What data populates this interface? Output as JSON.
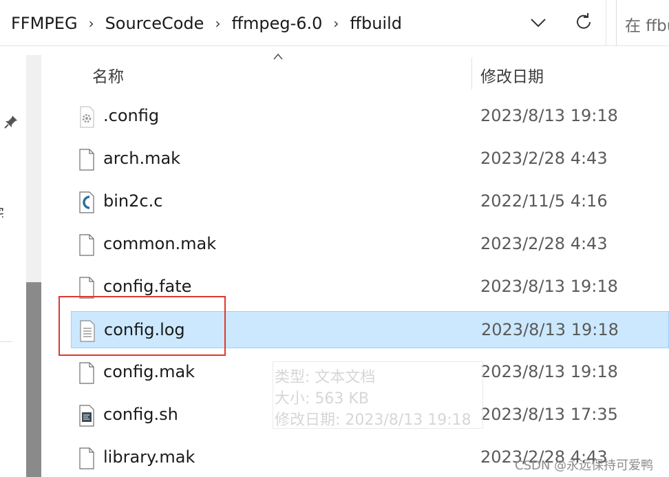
{
  "breadcrumb": {
    "segments": [
      "FFMPEG",
      "SourceCode",
      "ffmpeg-6.0",
      "ffbuild"
    ],
    "separator": "›"
  },
  "search": {
    "placeholder": "在 ffbuild"
  },
  "nav": {
    "fragment_text": "宅"
  },
  "columns": {
    "name": "名称",
    "date_modified": "修改日期"
  },
  "files": [
    {
      "name": ".config",
      "date": "2023/8/13 19:18",
      "icon": "config-file-icon",
      "selected": false
    },
    {
      "name": "arch.mak",
      "date": "2023/2/28 4:43",
      "icon": "blank-file-icon",
      "selected": false
    },
    {
      "name": "bin2c.c",
      "date": "2022/11/5 4:16",
      "icon": "c-source-file-icon",
      "selected": false
    },
    {
      "name": "common.mak",
      "date": "2023/2/28 4:43",
      "icon": "blank-file-icon",
      "selected": false
    },
    {
      "name": "config.fate",
      "date": "2023/8/13 19:18",
      "icon": "blank-file-icon",
      "selected": false
    },
    {
      "name": "config.log",
      "date": "2023/8/13 19:18",
      "icon": "text-document-icon",
      "selected": true
    },
    {
      "name": "config.mak",
      "date": "2023/8/13 19:18",
      "icon": "blank-file-icon",
      "selected": false
    },
    {
      "name": "config.sh",
      "date": "2023/8/13 17:35",
      "icon": "shell-script-icon",
      "selected": false
    },
    {
      "name": "library.mak",
      "date": "2023/2/28 4:43",
      "icon": "blank-file-icon",
      "selected": false
    }
  ],
  "tooltip": {
    "type_line": "类型: 文本文档",
    "size_line": "大小: 563 KB",
    "modified_line": "修改日期: 2023/8/13 19:18"
  },
  "watermark": "CSDN @永远保持可爱鸭",
  "colors": {
    "selection_bg": "#cce8ff",
    "selection_border": "#99d1ff",
    "highlight_box": "#e0362c",
    "scroll_thumb": "#8a8a8a"
  }
}
